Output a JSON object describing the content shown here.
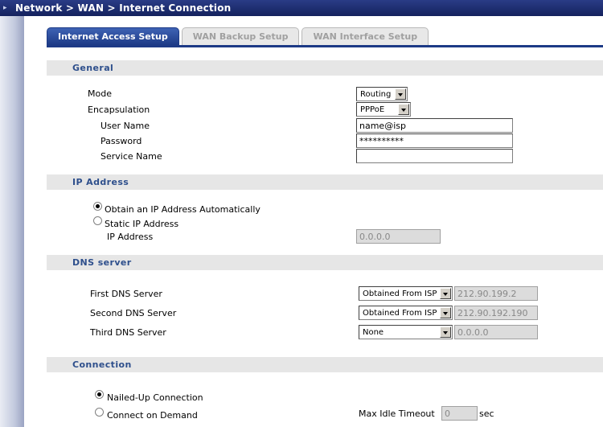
{
  "breadcrumb": "Network > WAN > Internet Connection",
  "tabs": [
    {
      "label": "Internet Access Setup"
    },
    {
      "label": "WAN Backup Setup"
    },
    {
      "label": "WAN Interface Setup"
    }
  ],
  "general": {
    "title": "General",
    "mode_label": "Mode",
    "mode_value": "Routing",
    "encap_label": "Encapsulation",
    "encap_value": "PPPoE",
    "username_label": "User Name",
    "username_value": "name@isp",
    "password_label": "Password",
    "password_value": "**********",
    "service_label": "Service Name",
    "service_value": ""
  },
  "ip": {
    "title": "IP Address",
    "auto_label": "Obtain an IP Address Automatically",
    "static_label": "Static IP Address",
    "address_label": "IP Address",
    "address_value": "0.0.0.0"
  },
  "dns": {
    "title": "DNS server",
    "first_label": "First DNS Server",
    "first_mode": "Obtained From ISP",
    "first_value": "212.90.199.2",
    "second_label": "Second DNS Server",
    "second_mode": "Obtained From ISP",
    "second_value": "212.90.192.190",
    "third_label": "Third DNS Server",
    "third_mode": "None",
    "third_value": "0.0.0.0"
  },
  "connection": {
    "title": "Connection",
    "nailed_label": "Nailed-Up Connection",
    "demand_label": "Connect on Demand",
    "idle_label": "Max Idle Timeout",
    "idle_value": "0",
    "idle_unit": "sec"
  }
}
